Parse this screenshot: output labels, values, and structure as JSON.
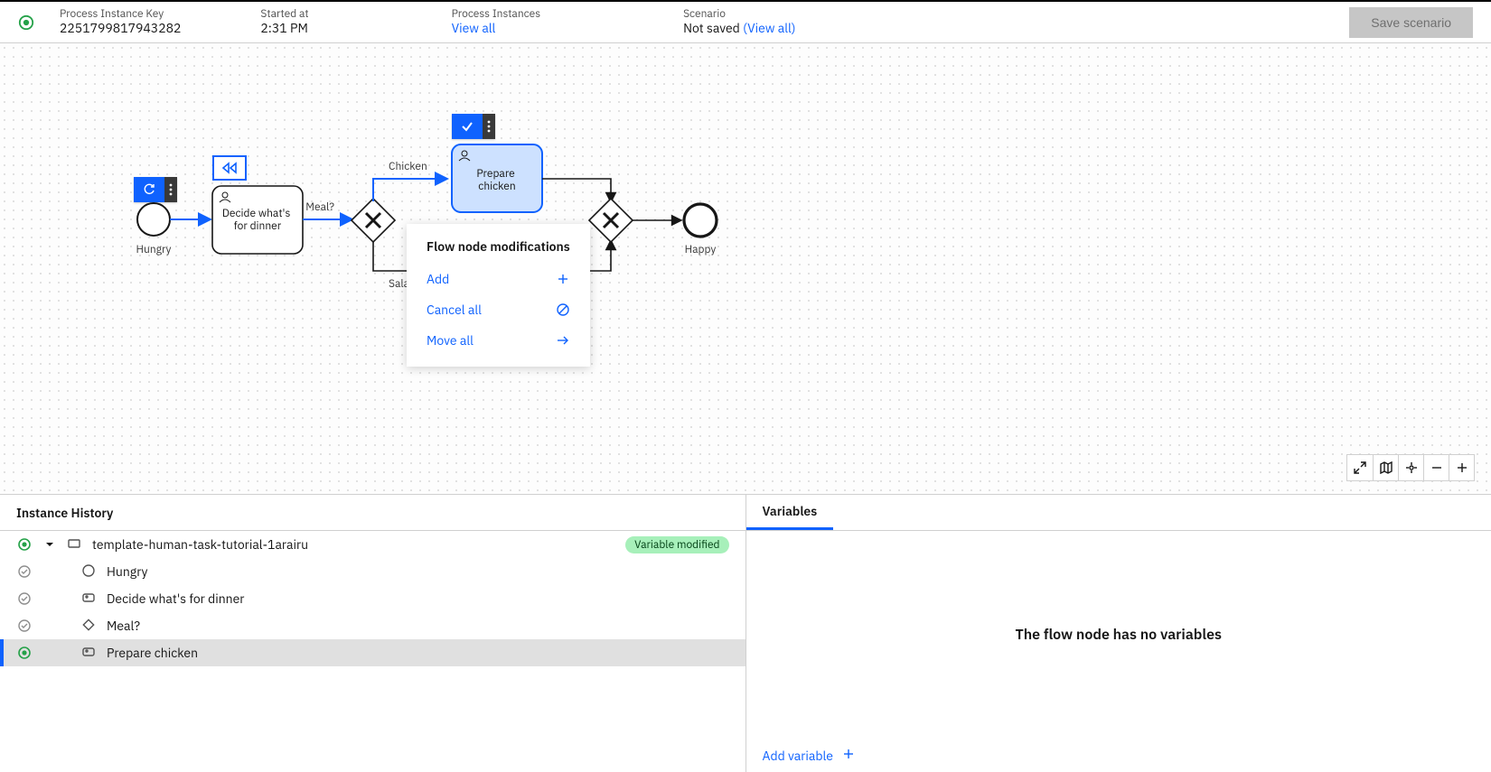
{
  "header": {
    "key_label": "Process Instance Key",
    "key_value": "2251799817943282",
    "started_label": "Started at",
    "started_value": "2:31 PM",
    "instances_label": "Process Instances",
    "instances_link": "View all",
    "scenario_label": "Scenario",
    "scenario_value": "Not saved",
    "scenario_link": "(View all)",
    "save_button": "Save scenario"
  },
  "diagram": {
    "start_label": "Hungry",
    "task_decide": "Decide what's\nfor dinner",
    "gateway_label": "Meal?",
    "branch_top": "Chicken",
    "branch_bottom": "Salad",
    "task_chicken_l1": "Prepare",
    "task_chicken_l2": "chicken",
    "end_label": "Happy"
  },
  "context_menu": {
    "title": "Flow node modifications",
    "add": "Add",
    "cancel": "Cancel all",
    "move": "Move all"
  },
  "bottom": {
    "history_title": "Instance History",
    "variables_tab": "Variables",
    "rows": [
      {
        "label": "template-human-task-tutorial-1arairu",
        "badge": "Variable modified"
      },
      {
        "label": "Hungry"
      },
      {
        "label": "Decide what's for dinner"
      },
      {
        "label": "Meal?"
      },
      {
        "label": "Prepare chicken"
      }
    ],
    "no_vars": "The flow node has no variables",
    "add_var": "Add variable"
  }
}
